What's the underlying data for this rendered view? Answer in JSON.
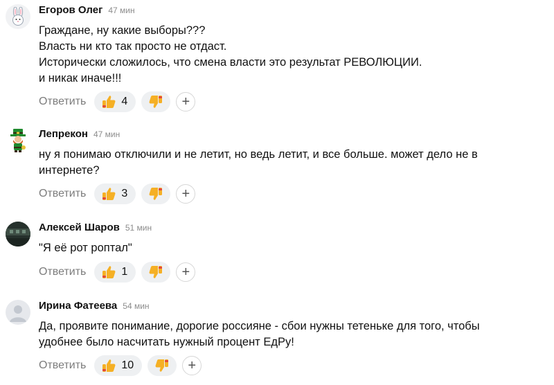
{
  "comments": [
    {
      "author": "Егоров Олег",
      "time": "47 мин",
      "text": "Граждане, ну какие выборы???\nВласть ни кто так просто не отдаст.\nИсторически сложилось, что смена власти это результат РЕВОЛЮЦИИ.\nи никак иначе!!!",
      "reply_label": "Ответить",
      "likes": "4",
      "avatar_icon": "rabbit-icon"
    },
    {
      "author": "Лепрекон",
      "time": "47 мин",
      "text": "ну я понимаю отключили и не летит, но ведь летит, и все больше. может дело не в\nинтернете?",
      "reply_label": "Ответить",
      "likes": "3",
      "avatar_icon": "leprechaun-icon"
    },
    {
      "author": "Алексей Шаров",
      "time": "51 мин",
      "text": "\"Я её рот роптал\"",
      "reply_label": "Ответить",
      "likes": "1",
      "avatar_icon": "photo-avatar"
    },
    {
      "author": "Ирина Фатеева",
      "time": "54 мин",
      "text": "Да, проявите понимание, дорогие россияне - сбои нужны тетеньке для того, чтобы\nудобнее было насчитать нужный процент ЕдРу!",
      "reply_label": "Ответить",
      "likes": "10",
      "avatar_icon": "default-user-icon"
    }
  ],
  "colors": {
    "pill_bg": "#eef0f2",
    "thumb": "#f5b025",
    "muted": "#8c8c8c"
  }
}
